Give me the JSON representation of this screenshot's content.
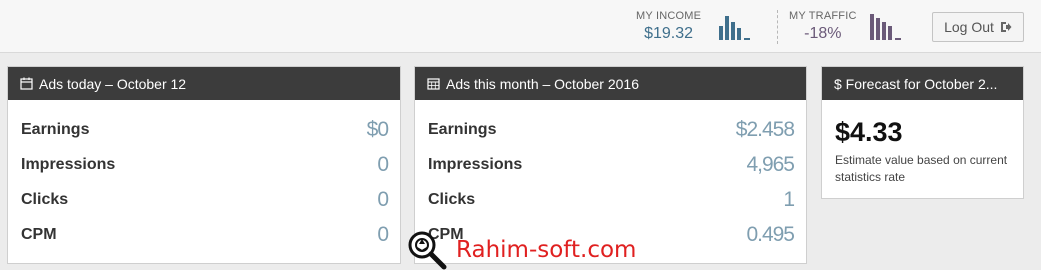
{
  "header": {
    "income": {
      "label": "MY INCOME",
      "value": "$19.32"
    },
    "traffic": {
      "label": "MY TRAFFIC",
      "value": "-18%"
    },
    "logout_label": "Log Out"
  },
  "colors": {
    "income": "#3f6f8c",
    "traffic": "#6b5a79",
    "panel_header": "#3c3c3c",
    "value": "#7f9eb0"
  },
  "panels": {
    "today": {
      "title": "Ads today – October 12",
      "icon": "calendar-icon",
      "rows": [
        {
          "label": "Earnings",
          "value": "$0"
        },
        {
          "label": "Impressions",
          "value": "0"
        },
        {
          "label": "Clicks",
          "value": "0"
        },
        {
          "label": "CPM",
          "value": "0"
        }
      ]
    },
    "month": {
      "title": "Ads this month – October 2016",
      "icon": "calendar-grid-icon",
      "rows": [
        {
          "label": "Earnings",
          "value": "$2.458"
        },
        {
          "label": "Impressions",
          "value": "4,965"
        },
        {
          "label": "Clicks",
          "value": "1"
        },
        {
          "label": "CPM",
          "value": "0.495"
        }
      ]
    },
    "forecast": {
      "title": "$ Forecast for October 2...",
      "amount": "$4.33",
      "description": "Estimate value based on current statistics rate"
    }
  },
  "watermark": {
    "text": "Rahim-soft.com",
    "icon": "magnifier-icon"
  }
}
